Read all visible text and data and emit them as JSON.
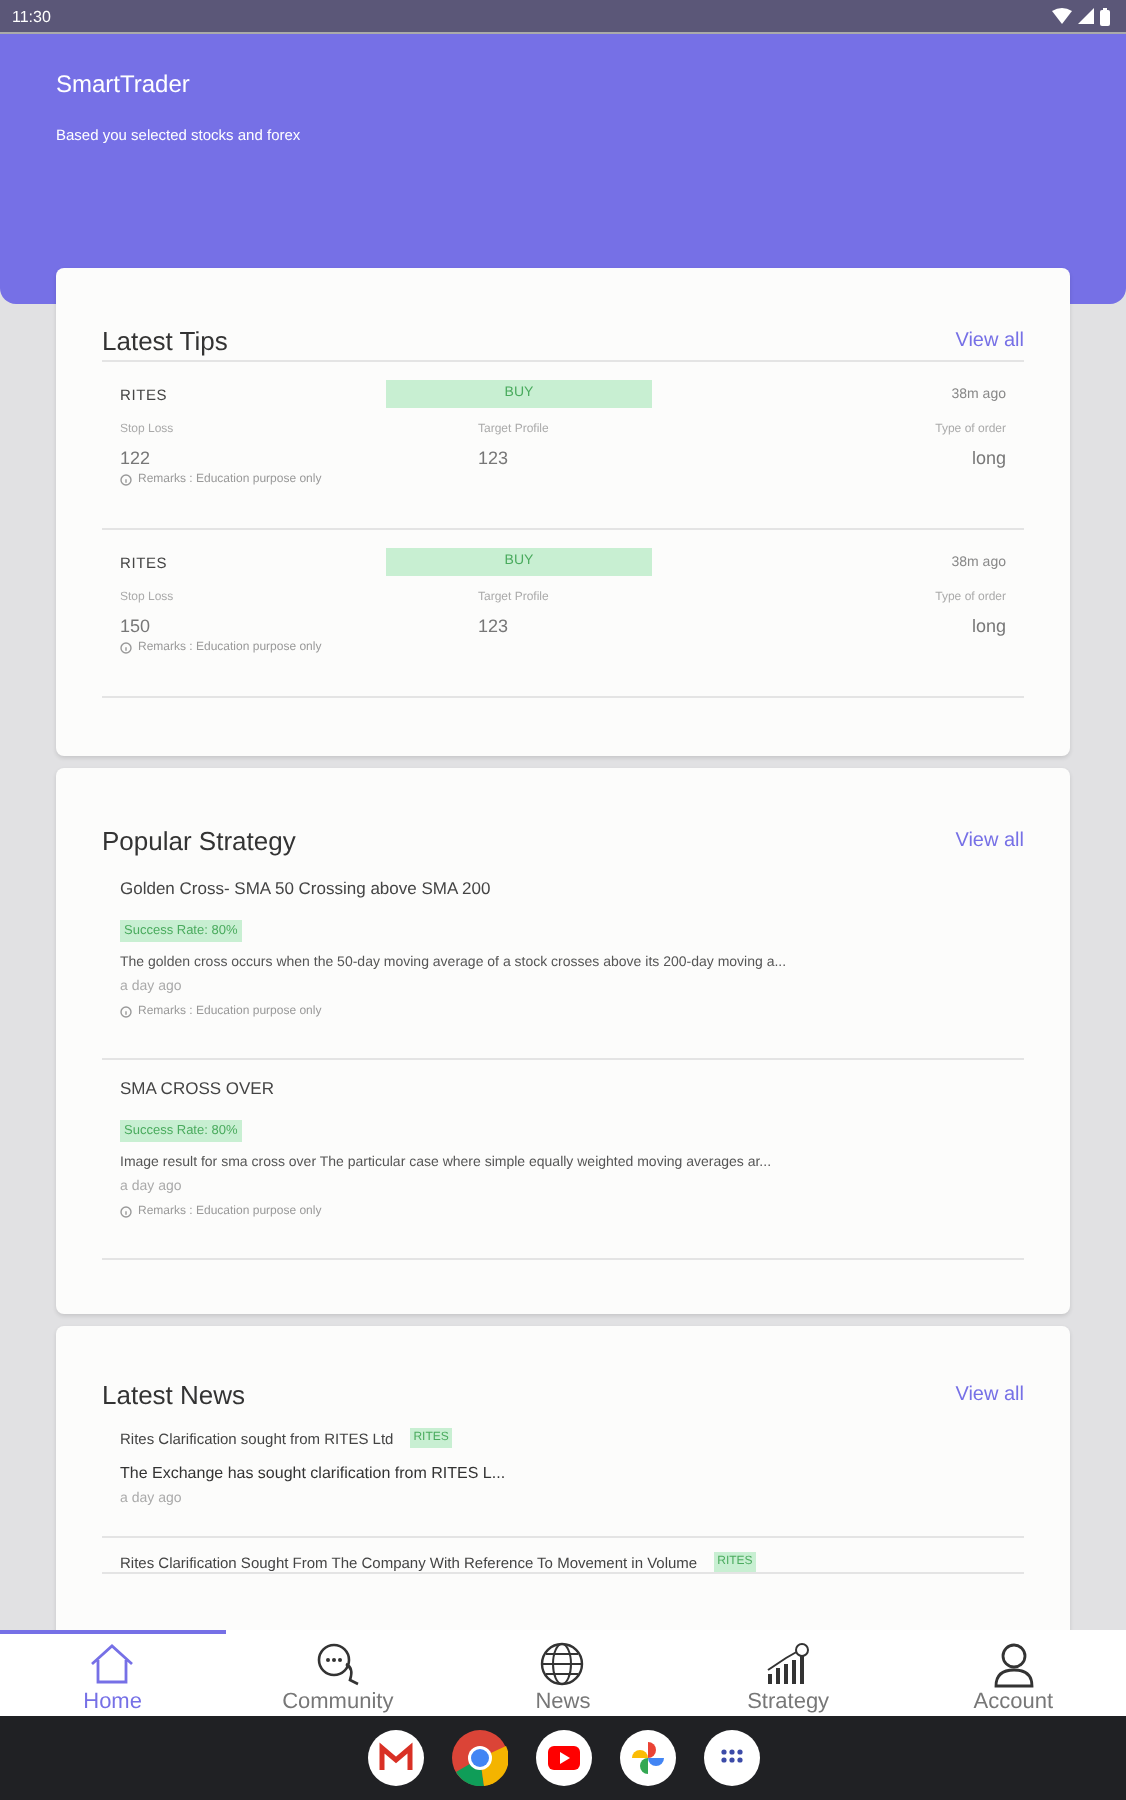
{
  "status_bar": {
    "time": "11:30"
  },
  "header": {
    "title": "SmartTrader",
    "subtitle": "Based you selected stocks and forex"
  },
  "tips": {
    "title": "Latest Tips",
    "view_all": "View all",
    "items": [
      {
        "symbol": "RITES",
        "action": "BUY",
        "time": "38m ago",
        "stop_loss_label": "Stop Loss",
        "stop_loss": "122",
        "target_label": "Target Profile",
        "target": "123",
        "order_type_label": "Type of order",
        "order_type": "long",
        "remarks": "Remarks : Education purpose only"
      },
      {
        "symbol": "RITES",
        "action": "BUY",
        "time": "38m ago",
        "stop_loss_label": "Stop Loss",
        "stop_loss": "150",
        "target_label": "Target Profile",
        "target": "123",
        "order_type_label": "Type of order",
        "order_type": "long",
        "remarks": "Remarks : Education purpose only"
      }
    ]
  },
  "strategy": {
    "title": "Popular Strategy",
    "view_all": "View all",
    "items": [
      {
        "name": "Golden Cross- SMA 50 Crossing above SMA 200",
        "success": "Success Rate: 80%",
        "description": "The golden cross occurs when the 50-day moving average of a stock crosses above its 200-day moving a...",
        "time": "a day ago",
        "remarks": "Remarks : Education purpose only"
      },
      {
        "name": "SMA CROSS OVER",
        "success": "Success Rate: 80%",
        "description": "Image result for sma cross over The particular case where simple equally weighted moving averages ar...",
        "time": "a day ago",
        "remarks": "Remarks : Education purpose only"
      }
    ]
  },
  "news": {
    "title": "Latest News",
    "view_all": "View all",
    "items": [
      {
        "headline": "Rites Clarification sought from RITES Ltd",
        "tag": "RITES",
        "summary": "The Exchange has sought clarification from RITES L...",
        "time": "a day ago"
      },
      {
        "headline": "Rites Clarification Sought From The Company With Reference To Movement in Volume",
        "tag": "RITES"
      }
    ]
  },
  "nav": [
    {
      "label": "Home",
      "kind": "home",
      "selected": true
    },
    {
      "label": "Community",
      "kind": "chat",
      "selected": false
    },
    {
      "label": "News",
      "kind": "globe",
      "selected": false
    },
    {
      "label": "Strategy",
      "kind": "chart",
      "selected": false
    },
    {
      "label": "Account",
      "kind": "person",
      "selected": false
    }
  ]
}
